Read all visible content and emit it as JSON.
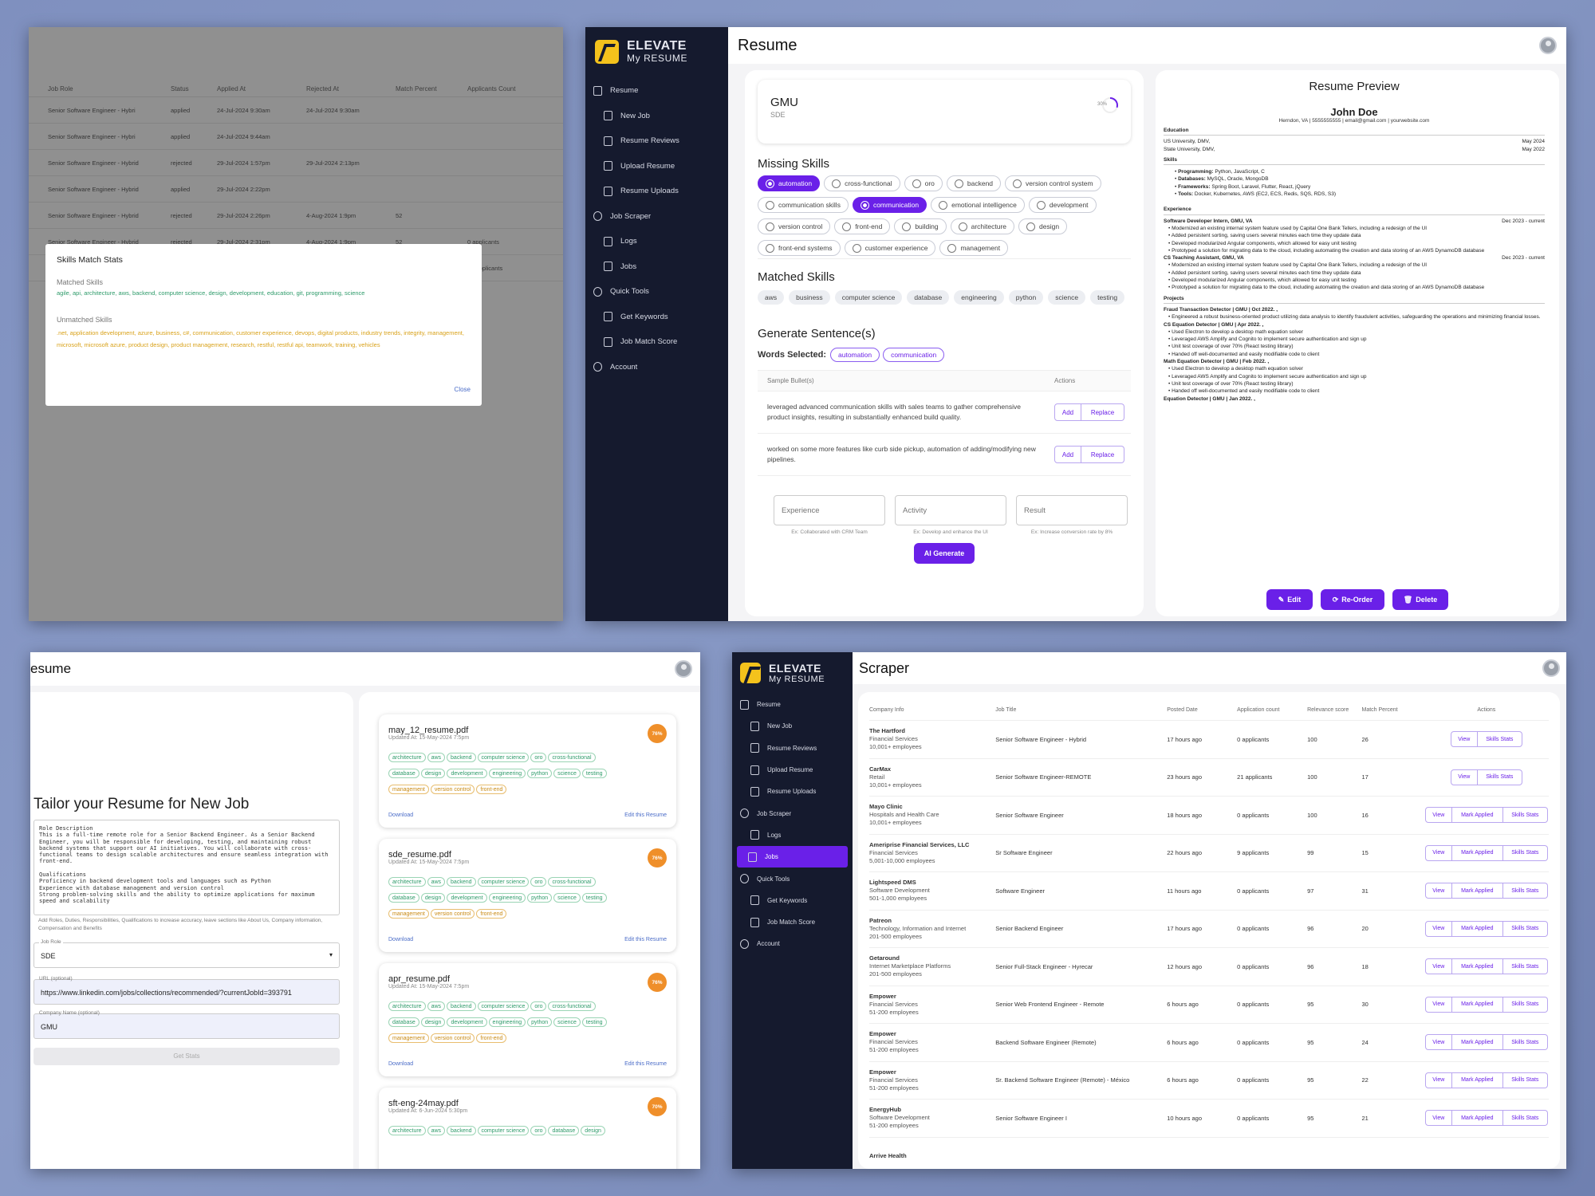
{
  "brand": {
    "line1": "ELEVATE",
    "line2": "My RESUME"
  },
  "nav": [
    {
      "label": "Resume",
      "type": "top",
      "icon": "document-icon"
    },
    {
      "label": "New Job",
      "type": "sub",
      "icon": "new-document-icon"
    },
    {
      "label": "Resume Reviews",
      "type": "sub",
      "icon": "review-icon"
    },
    {
      "label": "Upload Resume",
      "type": "sub",
      "icon": "upload-icon"
    },
    {
      "label": "Resume Uploads",
      "type": "sub",
      "icon": "files-icon"
    },
    {
      "label": "Job Scraper",
      "type": "top",
      "icon": "scraper-icon"
    },
    {
      "label": "Logs",
      "type": "sub",
      "icon": "logs-icon"
    },
    {
      "label": "Jobs",
      "type": "sub",
      "icon": "briefcase-icon"
    },
    {
      "label": "Quick Tools",
      "type": "top",
      "icon": "tools-icon"
    },
    {
      "label": "Get Keywords",
      "type": "sub",
      "icon": "keywords-icon"
    },
    {
      "label": "Job Match Score",
      "type": "sub",
      "icon": "score-icon"
    },
    {
      "label": "Account",
      "type": "top",
      "icon": "account-icon"
    }
  ],
  "panel1": {
    "columns": [
      "Job Role",
      "Status",
      "Applied At",
      "Rejected At",
      "Match Percent",
      "Applicants Count"
    ],
    "rows": [
      [
        "Senior Software Engineer - Hybri",
        "applied",
        "24-Jul-2024 9:30am",
        "24-Jul-2024 9:30am",
        "",
        ""
      ],
      [
        "Senior Software Engineer - Hybri",
        "applied",
        "24-Jul-2024 9:44am",
        "",
        "",
        ""
      ],
      [
        "Senior Software Engineer - Hybrid",
        "rejected",
        "29-Jul-2024 1:57pm",
        "29-Jul-2024 2:13pm",
        "",
        ""
      ],
      [
        "Senior Software Engineer - Hybrid",
        "applied",
        "29-Jul-2024 2:22pm",
        "",
        "",
        ""
      ],
      [
        "Senior Software Engineer - Hybrid",
        "rejected",
        "29-Jul-2024 2:26pm",
        "4-Aug-2024 1:9pm",
        "52",
        ""
      ],
      [
        "Senior Software Engineer - Hybrid",
        "rejected",
        "29-Jul-2024 2:31pm",
        "4-Aug-2024 1:9pm",
        "52",
        "0 applicants"
      ],
      [
        "",
        "",
        "",
        "",
        "",
        "21 applicants"
      ]
    ],
    "modal": {
      "title": "Skills Match Stats",
      "matched_label": "Matched Skills",
      "matched": "agile, api, architecture, aws, backend, computer science, design, development, education, git, programming, science",
      "unmatched_label": "Unmatched Skills",
      "unmatched": ".net, application development, azure, business, c#, communication, customer experience, devops, digital products, industry trends, integrity, management, microsoft, microsoft azure, product design, product management, research, restful, restful api, teamwork, training, vehicles",
      "close": "Close"
    }
  },
  "panel2": {
    "title": "Resume",
    "company": "GMU",
    "role": "SDE",
    "progress_label": "30%",
    "progress": 0.3,
    "missing_title": "Missing Skills",
    "missing": [
      {
        "label": "automation",
        "selected": true
      },
      {
        "label": "cross-functional",
        "selected": false
      },
      {
        "label": "oro",
        "selected": false
      },
      {
        "label": "backend",
        "selected": false
      },
      {
        "label": "version control system",
        "selected": false
      },
      {
        "label": "communication skills",
        "selected": false
      },
      {
        "label": "communication",
        "selected": true
      },
      {
        "label": "emotional intelligence",
        "selected": false
      },
      {
        "label": "development",
        "selected": false
      },
      {
        "label": "version control",
        "selected": false
      },
      {
        "label": "front-end",
        "selected": false
      },
      {
        "label": "building",
        "selected": false
      },
      {
        "label": "architecture",
        "selected": false
      },
      {
        "label": "design",
        "selected": false
      },
      {
        "label": "front-end systems",
        "selected": false
      },
      {
        "label": "customer experience",
        "selected": false
      },
      {
        "label": "management",
        "selected": false
      }
    ],
    "matched_title": "Matched Skills",
    "matched": [
      "aws",
      "business",
      "computer science",
      "database",
      "engineering",
      "python",
      "science",
      "testing"
    ],
    "gen_title": "Generate Sentence(s)",
    "words_label": "Words Selected:",
    "words": [
      "automation",
      "communication"
    ],
    "col_bullets": "Sample Bullet(s)",
    "col_actions": "Actions",
    "bullets": [
      "leveraged advanced communication skills with sales teams to gather comprehensive product insights, resulting in substantially enhanced build quality.",
      "worked on some more features like curb side pickup, automation of adding/modifying new pipelines."
    ],
    "add": "Add",
    "replace": "Replace",
    "inputs": [
      {
        "placeholder": "Experience",
        "hint": "Ex: Collaborated with CRM Team"
      },
      {
        "placeholder": "Activity",
        "hint": "Ex: Develop and enhance the UI"
      },
      {
        "placeholder": "Result",
        "hint": "Ex: Increase conversion rate by 8%"
      }
    ],
    "ai_generate": "AI Generate",
    "preview": {
      "title": "Resume Preview",
      "name": "John Doe",
      "contact": "Herndon, VA | 5555555555 | email@gmail.com | yourwebsite.com",
      "edu_title": "Education",
      "edu": [
        {
          "school": "US University, DMV,",
          "date": "May 2024"
        },
        {
          "school": "State University, DMV,",
          "date": "May 2022"
        }
      ],
      "skills_title": "Skills",
      "skills": [
        {
          "k": "Programming:",
          "v": "Python, JavaScript, C"
        },
        {
          "k": "Databases:",
          "v": "MySQL, Oracle, MongoDB"
        },
        {
          "k": "Frameworks:",
          "v": "Spring Boot, Laravel, Flutter, React, jQuery"
        },
        {
          "k": "Tools:",
          "v": "Docker, Kubernetes, AWS (EC2, ECS, Redis, SQS, RDS, S3)"
        }
      ],
      "exp_title": "Experience",
      "jobs": [
        {
          "title": "Software Developer Intern, GMU, VA",
          "date": "Dec 2023 - current",
          "bullets": [
            "Modernized an existing internal system feature used by Capital One Bank Tellers, including a redesign of the UI",
            "Added persistent sorting, saving users several minutes each time they update data",
            "Developed modularized Angular components, which allowed for easy unit testing",
            "Prototyped a solution for migrating data to the cloud, including automating the creation and data storing of an AWS DynamoDB database"
          ]
        },
        {
          "title": "CS Teaching Assistant, GMU, VA",
          "date": "Dec 2023 - current",
          "bullets": [
            "Modernized an existing internal system feature used by Capital One Bank Tellers, including a redesign of the UI",
            "Added persistent sorting, saving users several minutes each time they update data",
            "Developed modularized Angular components, which allowed for easy unit testing",
            "Prototyped a solution for migrating data to the cloud, including automating the creation and data storing of an AWS DynamoDB database"
          ]
        }
      ],
      "proj_title": "Projects",
      "projects": [
        {
          "title": "Fraud Transaction Detector | GMU | Oct 2022. ,",
          "bullets": [
            "Engineered a robust business-oriented product utilizing data analysis to identify fraudulent activities, safeguarding the operations and minimizing financial losses."
          ]
        },
        {
          "title": "CS Equation Detector | GMU | Apr 2022. ,",
          "bullets": [
            "Used Electron to develop a desktop math equation solver",
            "Leveraged AWS Amplify and Cognito to implement secure authentication and sign up",
            "Unit test coverage of over 70% (React testing library)",
            "Handed off well-documented and easily modifiable code to client"
          ]
        },
        {
          "title": "Math Equation Detector | GMU | Feb 2022. ,",
          "bullets": [
            "Used Electron to develop a desktop math equation solver",
            "Leveraged AWS Amplify and Cognito to implement secure authentication and sign up",
            "Unit test coverage of over 70% (React testing library)",
            "Handed off well-documented and easily modifiable code to client"
          ]
        },
        {
          "title": "Equation Detector | GMU | Jan 2022. ,",
          "bullets": []
        }
      ],
      "edit": "Edit",
      "reorder": "Re-Order",
      "delete": "Delete"
    }
  },
  "panel3": {
    "title": "esume",
    "heading": "Tailor your Resume for New Job",
    "jd": "Role Description\nThis is a full-time remote role for a Senior Backend Engineer. As a Senior Backend Engineer, you will be responsible for developing, testing, and maintaining robust backend systems that support our AI initiatives. You will collaborate with cross-functional teams to design scalable architectures and ensure seamless integration with front-end.\n\nQualifications\nProficiency in backend development tools and languages such as Python\nExperience with database management and version control\nStrong problem-solving skills and the ability to optimize applications for maximum speed and scalability",
    "jd_hint": "Add Roles, Duties, Responsibilities, Qualifications to increase accuracy, leave sections like About Us, Company information, Compensation and Benefits",
    "job_role_label": "Job Role",
    "job_role": "SDE",
    "url_label": "URL (optional)",
    "url": "https://www.linkedin.com/jobs/collections/recommended/?currentJobId=393791",
    "company_label": "Company Name (optional)",
    "company": "GMU",
    "get_stats": "Get Stats",
    "resumes": [
      {
        "name": "may_12_resume.pdf",
        "updated": "Updated At: 15-May-2024 7:5pm",
        "pct": "76%",
        "tags": [
          "architecture",
          "aws",
          "backend",
          "computer science",
          "oro",
          "cross-functional",
          "database",
          "design",
          "development",
          "engineering",
          "python",
          "science",
          "testing"
        ],
        "otags": [
          "management",
          "version control",
          "front-end"
        ]
      },
      {
        "name": "sde_resume.pdf",
        "updated": "Updated At: 15-May-2024 7:5pm",
        "pct": "76%",
        "tags": [
          "architecture",
          "aws",
          "backend",
          "computer science",
          "oro",
          "cross-functional",
          "database",
          "design",
          "development",
          "engineering",
          "python",
          "science",
          "testing"
        ],
        "otags": [
          "management",
          "version control",
          "front-end"
        ]
      },
      {
        "name": "apr_resume.pdf",
        "updated": "Updated At: 15-May-2024 7:5pm",
        "pct": "76%",
        "tags": [
          "architecture",
          "aws",
          "backend",
          "computer science",
          "oro",
          "cross-functional",
          "database",
          "design",
          "development",
          "engineering",
          "python",
          "science",
          "testing"
        ],
        "otags": [
          "management",
          "version control",
          "front-end"
        ]
      },
      {
        "name": "sft-eng-24may.pdf",
        "updated": "Updated At: 6-Jun-2024 5:30pm",
        "pct": "70%",
        "tags": [
          "architecture",
          "aws",
          "backend",
          "computer science",
          "oro",
          "database",
          "design"
        ],
        "otags": []
      }
    ],
    "download": "Download",
    "edit_resume": "Edit this Resume"
  },
  "panel4": {
    "title": "Scraper",
    "columns": [
      "Company Info",
      "Job Title",
      "Posted Date",
      "Application count",
      "Relevance score",
      "Match Percent",
      "Actions"
    ],
    "view": "View",
    "mark": "Mark Applied",
    "stats": "Skills Stats",
    "rows": [
      {
        "co": "The Hartford",
        "ind": "Financial Services",
        "size": "10,001+ employees",
        "title": "Senior Software Engineer - Hybrid",
        "posted": "17 hours ago",
        "apps": "0 applicants",
        "rel": "100",
        "match": "26",
        "applied": true
      },
      {
        "co": "CarMax",
        "ind": "Retail",
        "size": "10,001+ employees",
        "title": "Senior Software Engineer-REMOTE",
        "posted": "23 hours ago",
        "apps": "21 applicants",
        "rel": "100",
        "match": "17",
        "applied": true
      },
      {
        "co": "Mayo Clinic",
        "ind": "Hospitals and Health Care",
        "size": "10,001+ employees",
        "title": "Senior Software Engineer",
        "posted": "18 hours ago",
        "apps": "0 applicants",
        "rel": "100",
        "match": "16",
        "applied": false
      },
      {
        "co": "Ameriprise Financial Services, LLC",
        "ind": "Financial Services",
        "size": "5,001-10,000 employees",
        "title": "Sr Software Engineer",
        "posted": "22 hours ago",
        "apps": "9 applicants",
        "rel": "99",
        "match": "15",
        "applied": false
      },
      {
        "co": "Lightspeed DMS",
        "ind": "Software Development",
        "size": "501-1,000 employees",
        "title": "Software Engineer",
        "posted": "11 hours ago",
        "apps": "0 applicants",
        "rel": "97",
        "match": "31",
        "applied": false
      },
      {
        "co": "Patreon",
        "ind": "Technology, Information and Internet",
        "size": "201-500 employees",
        "title": "Senior Backend Engineer",
        "posted": "17 hours ago",
        "apps": "0 applicants",
        "rel": "96",
        "match": "20",
        "applied": false
      },
      {
        "co": "Getaround",
        "ind": "Internet Marketplace Platforms",
        "size": "201-500 employees",
        "title": "Senior Full-Stack Engineer - Hyrecar",
        "posted": "12 hours ago",
        "apps": "0 applicants",
        "rel": "96",
        "match": "18",
        "applied": false
      },
      {
        "co": "Empower",
        "ind": "Financial Services",
        "size": "51-200 employees",
        "title": "Senior Web Frontend Engineer - Remote",
        "posted": "6 hours ago",
        "apps": "0 applicants",
        "rel": "95",
        "match": "30",
        "applied": false
      },
      {
        "co": "Empower",
        "ind": "Financial Services",
        "size": "51-200 employees",
        "title": "Backend Software Engineer (Remote)",
        "posted": "6 hours ago",
        "apps": "0 applicants",
        "rel": "95",
        "match": "24",
        "applied": false
      },
      {
        "co": "Empower",
        "ind": "Financial Services",
        "size": "51-200 employees",
        "title": "Sr. Backend Software Engineer (Remote) - México",
        "posted": "6 hours ago",
        "apps": "0 applicants",
        "rel": "95",
        "match": "22",
        "applied": false
      },
      {
        "co": "EnergyHub",
        "ind": "Software Development",
        "size": "51-200 employees",
        "title": "Senior Software Engineer I",
        "posted": "10 hours ago",
        "apps": "0 applicants",
        "rel": "95",
        "match": "21",
        "applied": false
      },
      {
        "co": "Arrive Health",
        "ind": "",
        "size": "",
        "title": "",
        "posted": "",
        "apps": "",
        "rel": "",
        "match": "",
        "applied": false
      }
    ]
  },
  "colors": {
    "accent": "#6a20e8",
    "sidebar": "#151a2e",
    "matched": "#2e9b6a",
    "unmatched": "#d9a21a"
  }
}
